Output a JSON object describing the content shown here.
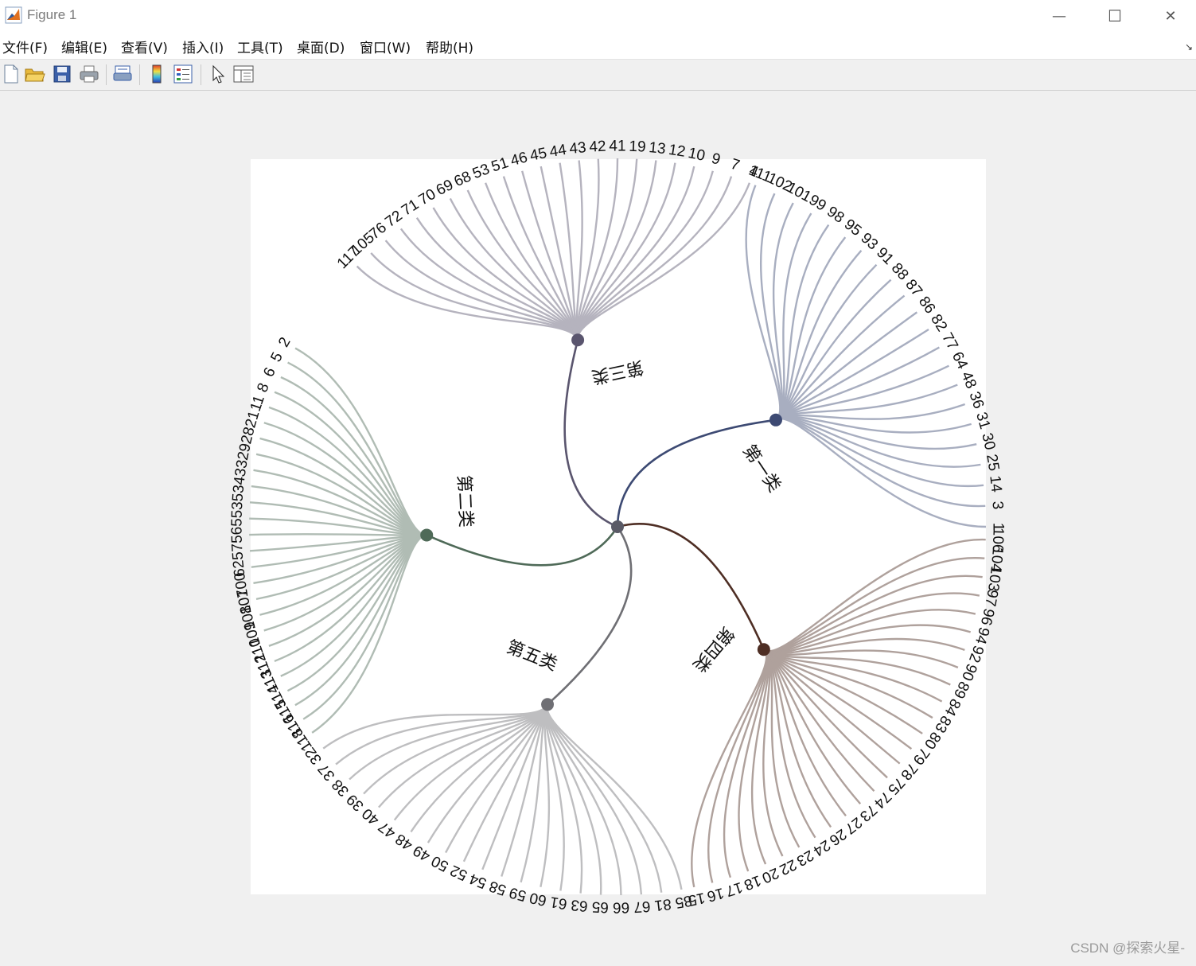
{
  "window": {
    "title": "Figure 1",
    "minimize_glyph": "—",
    "maximize_glyph": "☐",
    "close_glyph": "✕"
  },
  "menu": [
    {
      "label": "文件(F)"
    },
    {
      "label": "编辑(E)"
    },
    {
      "label": "查看(V)"
    },
    {
      "label": "插入(I)"
    },
    {
      "label": "工具(T)"
    },
    {
      "label": "桌面(D)"
    },
    {
      "label": "窗口(W)"
    },
    {
      "label": "帮助(H)"
    }
  ],
  "toolbar": {
    "buttons": [
      "new-file-icon",
      "open-folder-icon",
      "save-icon",
      "print-icon",
      "print-preview-icon",
      "colorbar-icon",
      "legend-icon",
      "pointer-icon",
      "property-panel-icon"
    ]
  },
  "watermark": "CSDN @探索火星-",
  "chart_data": {
    "type": "radial-dendrogram",
    "root_color": "#5a5a66",
    "clusters": [
      {
        "label": "第一类",
        "color": "#3d4a73",
        "leaves": [
          "111",
          "102",
          "101",
          "99",
          "98",
          "95",
          "93",
          "91",
          "88",
          "87",
          "86",
          "82",
          "77",
          "64",
          "48",
          "36",
          "31",
          "30",
          "25",
          "14",
          "3",
          "1"
        ]
      },
      {
        "label": "第四类",
        "color": "#4e2e24",
        "leaves": [
          "106",
          "104",
          "103",
          "97",
          "96",
          "94",
          "92",
          "90",
          "89",
          "84",
          "83",
          "80",
          "79",
          "78",
          "75",
          "74",
          "73",
          "27",
          "26",
          "24",
          "23",
          "22",
          "20",
          "18",
          "17",
          "16",
          "15"
        ]
      },
      {
        "label": "第五类",
        "color": "#6f6f74",
        "leaves": [
          "85",
          "81",
          "67",
          "66",
          "65",
          "63",
          "61",
          "60",
          "59",
          "58",
          "54",
          "52",
          "50",
          "49",
          "48",
          "47",
          "40",
          "39",
          "38",
          "37",
          "32"
        ]
      },
      {
        "label": "第二类",
        "color": "#4f6a58",
        "leaves": [
          "118",
          "116",
          "115",
          "114",
          "113",
          "112",
          "110",
          "109",
          "108",
          "107",
          "100",
          "62",
          "57",
          "56",
          "55",
          "35",
          "34",
          "33",
          "29",
          "28",
          "21",
          "11",
          "8",
          "6",
          "5",
          "2"
        ]
      },
      {
        "label": "第三类",
        "color": "#5a556e",
        "leaves": [
          "117",
          "105",
          "76",
          "72",
          "71",
          "70",
          "69",
          "68",
          "53",
          "51",
          "46",
          "45",
          "44",
          "43",
          "42",
          "41",
          "19",
          "13",
          "12",
          "10",
          "9",
          "7",
          "4"
        ]
      }
    ]
  }
}
